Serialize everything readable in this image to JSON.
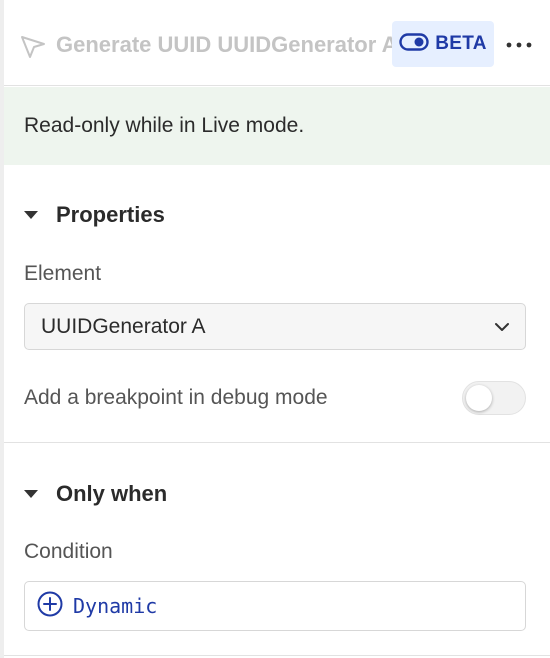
{
  "header": {
    "title": "Generate UUID UUIDGenerator A",
    "beta_label": "BETA",
    "icons": {
      "action": "cursor-arrow-icon",
      "beta": "toggle-icon",
      "more": "more-horizontal-icon"
    }
  },
  "notice": {
    "text": "Read-only while in Live mode."
  },
  "properties": {
    "title": "Properties",
    "element_label": "Element",
    "element_value": "UUIDGenerator A",
    "breakpoint_label": "Add a breakpoint in debug mode",
    "breakpoint_enabled": false
  },
  "only_when": {
    "title": "Only when",
    "condition_label": "Condition",
    "dynamic_label": "Dynamic"
  },
  "colors": {
    "accent": "#1f3aa6",
    "beta_bg": "#e6efff",
    "notice_bg": "#eef5ee",
    "title_muted": "#c4c4c4"
  }
}
